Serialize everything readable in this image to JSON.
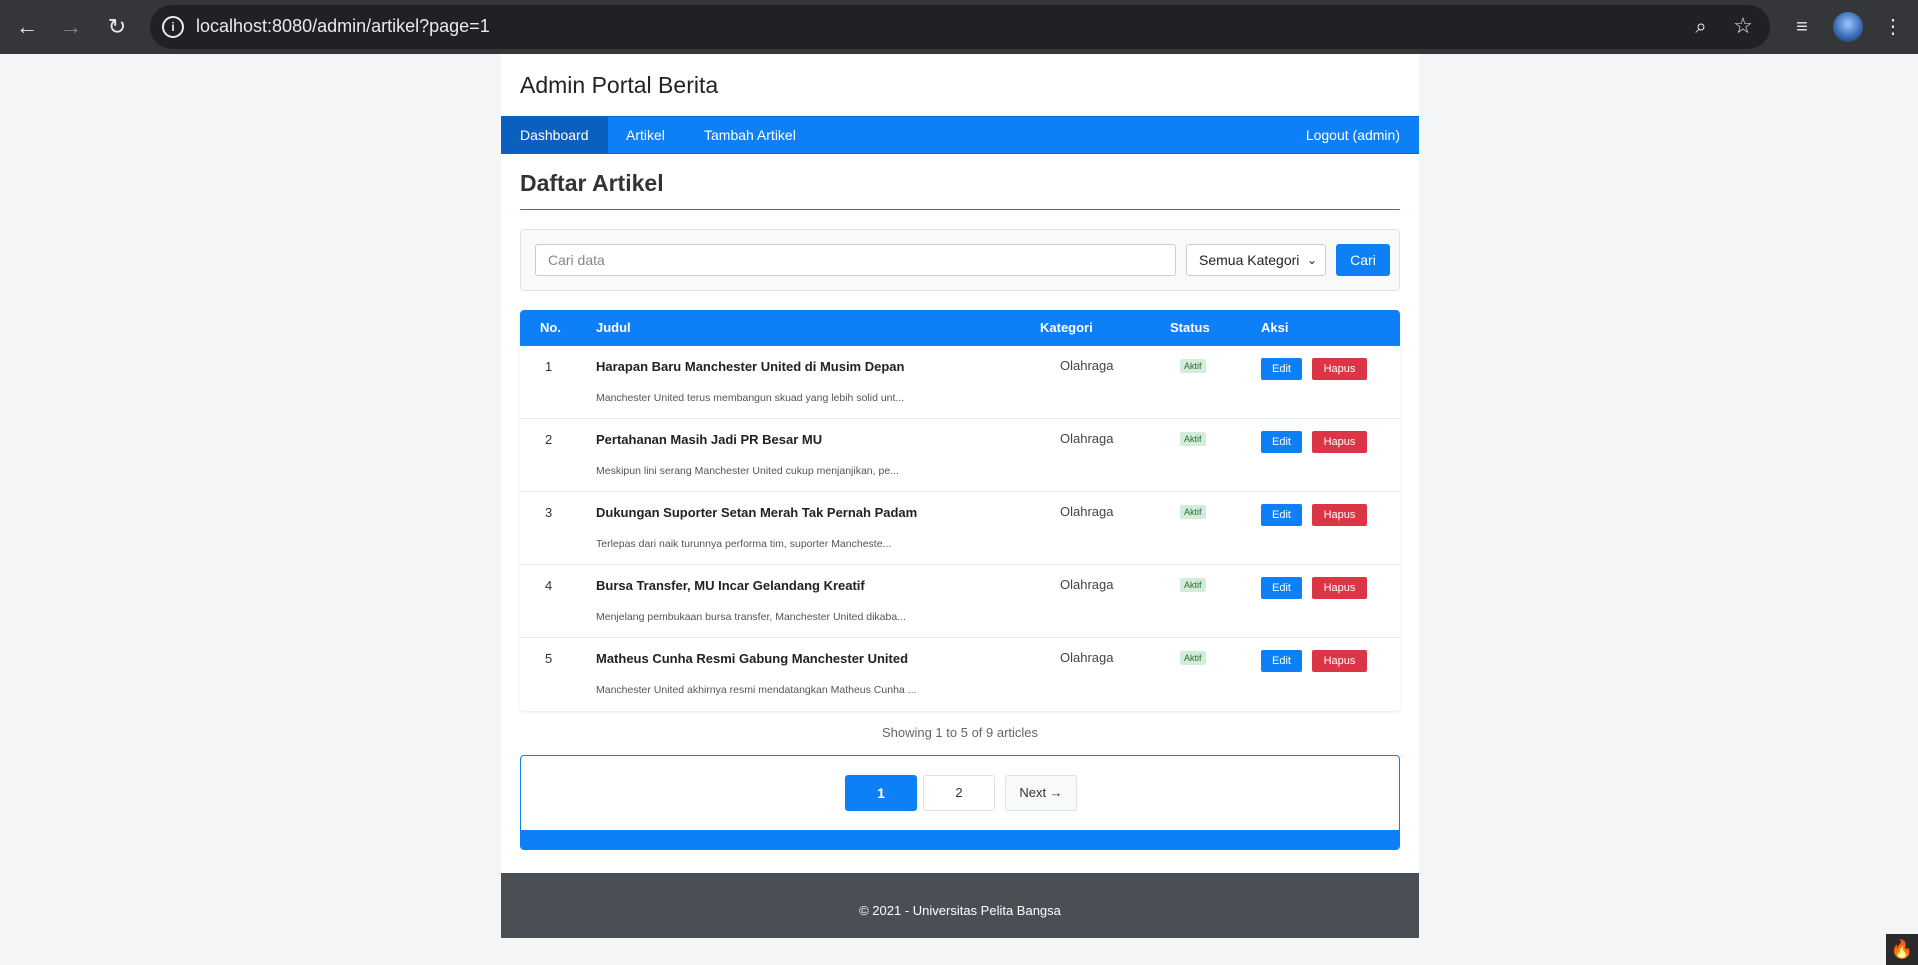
{
  "browser": {
    "url": "localhost:8080/admin/artikel?page=1",
    "back_icon": "←",
    "forward_icon": "→",
    "reload_icon": "↻",
    "info_icon": "i",
    "zoom_icon": "⌕",
    "star_icon": "☆",
    "media_icon": "≡",
    "menu_icon": "⋮"
  },
  "site": {
    "title": "Admin Portal Berita"
  },
  "nav": {
    "items": [
      {
        "label": "Dashboard",
        "active": true
      },
      {
        "label": "Artikel",
        "active": false
      },
      {
        "label": "Tambah Artikel",
        "active": false
      }
    ],
    "logout": "Logout (admin)"
  },
  "page": {
    "title": "Daftar Artikel"
  },
  "search": {
    "placeholder": "Cari data",
    "category": "Semua Kategori",
    "button": "Cari"
  },
  "table": {
    "headers": [
      "No.",
      "Judul",
      "Kategori",
      "Status",
      "Aksi"
    ],
    "rows": [
      {
        "no": "1",
        "judul": "Harapan Baru Manchester United di Musim Depan",
        "excerpt": "Manchester United terus membangun skuad yang lebih solid unt...",
        "kategori": "Olahraga",
        "status": "Aktif",
        "edit": "Edit",
        "hapus": "Hapus"
      },
      {
        "no": "2",
        "judul": "Pertahanan Masih Jadi PR Besar MU",
        "excerpt": "Meskipun lini serang Manchester United cukup menjanjikan, pe...",
        "kategori": "Olahraga",
        "status": "Aktif",
        "edit": "Edit",
        "hapus": "Hapus"
      },
      {
        "no": "3",
        "judul": "Dukungan Suporter Setan Merah Tak Pernah Padam",
        "excerpt": "Terlepas dari naik turunnya performa tim, suporter Mancheste...",
        "kategori": "Olahraga",
        "status": "Aktif",
        "edit": "Edit",
        "hapus": "Hapus"
      },
      {
        "no": "4",
        "judul": "Bursa Transfer, MU Incar Gelandang Kreatif",
        "excerpt": "Menjelang pembukaan bursa transfer, Manchester United dikaba...",
        "kategori": "Olahraga",
        "status": "Aktif",
        "edit": "Edit",
        "hapus": "Hapus"
      },
      {
        "no": "5",
        "judul": "Matheus Cunha Resmi Gabung Manchester United",
        "excerpt": "Manchester United akhirnya resmi mendatangkan Matheus Cunha ...",
        "kategori": "Olahraga",
        "status": "Aktif",
        "edit": "Edit",
        "hapus": "Hapus"
      }
    ]
  },
  "pagination": {
    "showing": "Showing 1 to 5 of 9 articles",
    "pages": [
      "1",
      "2"
    ],
    "next": "Next →"
  },
  "footer": {
    "text": "© 2021 - Universitas Pelita Bangsa"
  },
  "colors": {
    "primary": "#0d7ff7",
    "danger": "#dc3545",
    "footer": "#4a4f55"
  }
}
